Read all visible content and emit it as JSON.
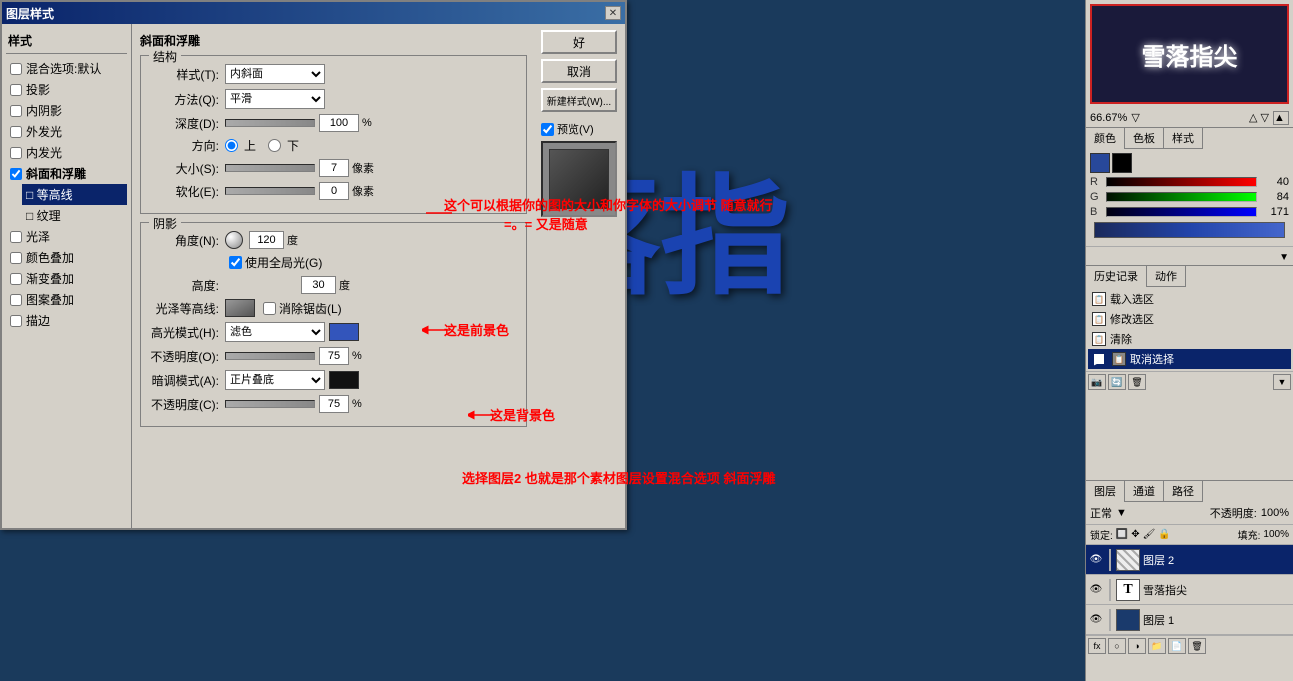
{
  "dialog": {
    "title": "图层样式",
    "close_label": "✕",
    "sidebar": {
      "title": "样式",
      "items": [
        {
          "label": "混合选项:默认",
          "checked": false,
          "selected": false
        },
        {
          "label": "投影",
          "checked": false,
          "selected": false
        },
        {
          "label": "内阴影",
          "checked": false,
          "selected": false
        },
        {
          "label": "外发光",
          "checked": false,
          "selected": false
        },
        {
          "label": "内发光",
          "checked": false,
          "selected": false
        },
        {
          "label": "斜面和浮雕",
          "checked": true,
          "selected": false
        },
        {
          "label": "等高线",
          "sub": true,
          "checked": false,
          "selected": true
        },
        {
          "label": "纹理",
          "sub": true,
          "checked": false,
          "selected": false
        },
        {
          "label": "光泽",
          "checked": false,
          "selected": false
        },
        {
          "label": "颜色叠加",
          "checked": false,
          "selected": false
        },
        {
          "label": "渐变叠加",
          "checked": false,
          "selected": false
        },
        {
          "label": "图案叠加",
          "checked": false,
          "selected": false
        },
        {
          "label": "描边",
          "checked": false,
          "selected": false
        }
      ]
    },
    "main": {
      "section_title": "斜面和浮雕",
      "structure": {
        "group_label": "结构",
        "style_label": "样式(T):",
        "style_value": "内斜面",
        "method_label": "方法(Q):",
        "method_value": "平滑",
        "depth_label": "深度(D):",
        "depth_value": "100",
        "depth_unit": "%",
        "direction_label": "方向:",
        "direction_up": "上",
        "direction_down": "下",
        "size_label": "大小(S):",
        "size_value": "7",
        "size_unit": "像素",
        "soften_label": "软化(E):",
        "soften_value": "0",
        "soften_unit": "像素"
      },
      "shadow": {
        "group_label": "阴影",
        "angle_label": "角度(N):",
        "angle_value": "120",
        "angle_unit": "度",
        "global_light_label": "使用全局光(G)",
        "altitude_label": "高度:",
        "altitude_value": "30",
        "altitude_unit": "度",
        "gloss_label": "光泽等高线:",
        "anti_alias_label": "消除锯齿(L)",
        "highlight_mode_label": "高光模式(H):",
        "highlight_mode_value": "滤色",
        "highlight_opacity_label": "不透明度(O):",
        "highlight_opacity_value": "75",
        "shadow_mode_label": "暗调模式(A):",
        "shadow_mode_value": "正片叠底",
        "shadow_opacity_label": "不透明度(C):",
        "shadow_opacity_value": "75"
      }
    },
    "buttons": {
      "ok": "好",
      "cancel": "取消",
      "new_style": "新建样式(W)...",
      "preview_label": "预览(V)"
    }
  },
  "annotations": [
    {
      "id": "ann1",
      "text": "这个可以根据你的图的大小和你字体的大小调节  随意就行",
      "sub": "=。= 又是随意"
    },
    {
      "id": "ann2",
      "text": "这是前景色"
    },
    {
      "id": "ann3",
      "text": "这是背景色"
    },
    {
      "id": "ann4",
      "text": "选择图层2  也就是那个素材图层设置混合选项  斜面浮雕"
    }
  ],
  "right_panel": {
    "thumbnail": {
      "text": "雪落指尖"
    },
    "zoom": {
      "value": "66.67%"
    },
    "color_panel": {
      "title": "颜色",
      "tabs": [
        "颜色",
        "色板",
        "样式"
      ],
      "r": {
        "label": "R",
        "value": 40
      },
      "g": {
        "label": "G",
        "value": 84
      },
      "b": {
        "label": "B",
        "value": 171
      }
    },
    "history_panel": {
      "tabs": [
        "历史记录",
        "动作"
      ],
      "items": [
        {
          "label": "载入选区"
        },
        {
          "label": "修改选区"
        },
        {
          "label": "清除"
        },
        {
          "label": "取消选择",
          "selected": true
        }
      ]
    },
    "layers_panel": {
      "tabs": [
        "图层",
        "通道",
        "路径"
      ],
      "blend_mode": "正常",
      "opacity": "100%",
      "fill": "100%",
      "lock_label": "锁定:",
      "layers": [
        {
          "name": "图层 2",
          "selected": true,
          "type": "image"
        },
        {
          "name": "雪落指尖",
          "selected": false,
          "type": "text"
        },
        {
          "name": "图层 1",
          "selected": false,
          "type": "color"
        }
      ]
    }
  }
}
